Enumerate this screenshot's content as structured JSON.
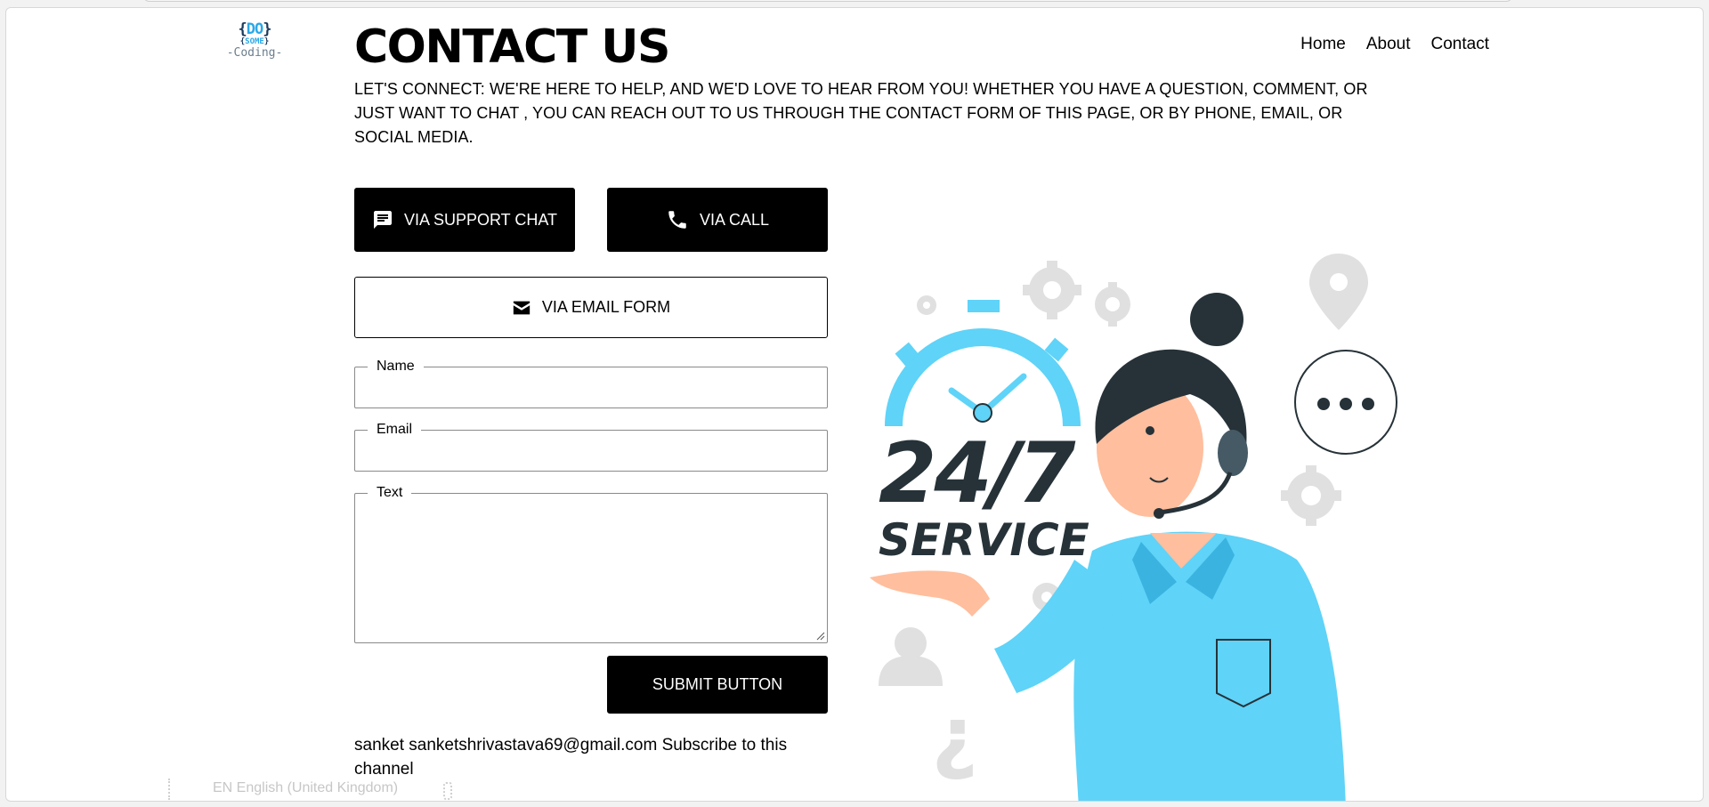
{
  "logo": {
    "line1": "DO",
    "line2": "SOME",
    "line3": "-Coding-"
  },
  "header": {
    "title": "CONTACT US",
    "nav": [
      {
        "label": "Home"
      },
      {
        "label": "About"
      },
      {
        "label": "Contact"
      }
    ]
  },
  "intro": "LET'S CONNECT: WE'RE HERE TO HELP, AND WE'D LOVE TO HEAR FROM YOU! WHETHER YOU HAVE A QUESTION, COMMENT, OR JUST WANT TO CHAT , YOU CAN REACH OUT TO US THROUGH THE CONTACT FORM OF THIS PAGE, OR BY PHONE, EMAIL, OR SOCIAL MEDIA.",
  "contact_buttons": {
    "chat": {
      "label": "VIA SUPPORT CHAT",
      "icon": "chat-bubble-icon"
    },
    "call": {
      "label": "VIA CALL",
      "icon": "phone-icon"
    },
    "email": {
      "label": "VIA EMAIL FORM",
      "icon": "envelope-icon"
    }
  },
  "form": {
    "name": {
      "legend": "Name",
      "value": ""
    },
    "email": {
      "legend": "Email",
      "value": ""
    },
    "text": {
      "legend": "Text",
      "value": ""
    },
    "submit_label": "SUBMIT BUTTON"
  },
  "footer_line": "sanket sanketshrivastava69@gmail.com Subscribe to this channel",
  "language": "EN English (United Kingdom)",
  "illustration": {
    "big_text": "24/7",
    "sub_text": "SERVICE"
  },
  "colors": {
    "accent_blue": "#5fd3f8",
    "dark_navy": "#263238",
    "skin": "#ffbe9d",
    "gear_gray": "#e0e0e0"
  }
}
